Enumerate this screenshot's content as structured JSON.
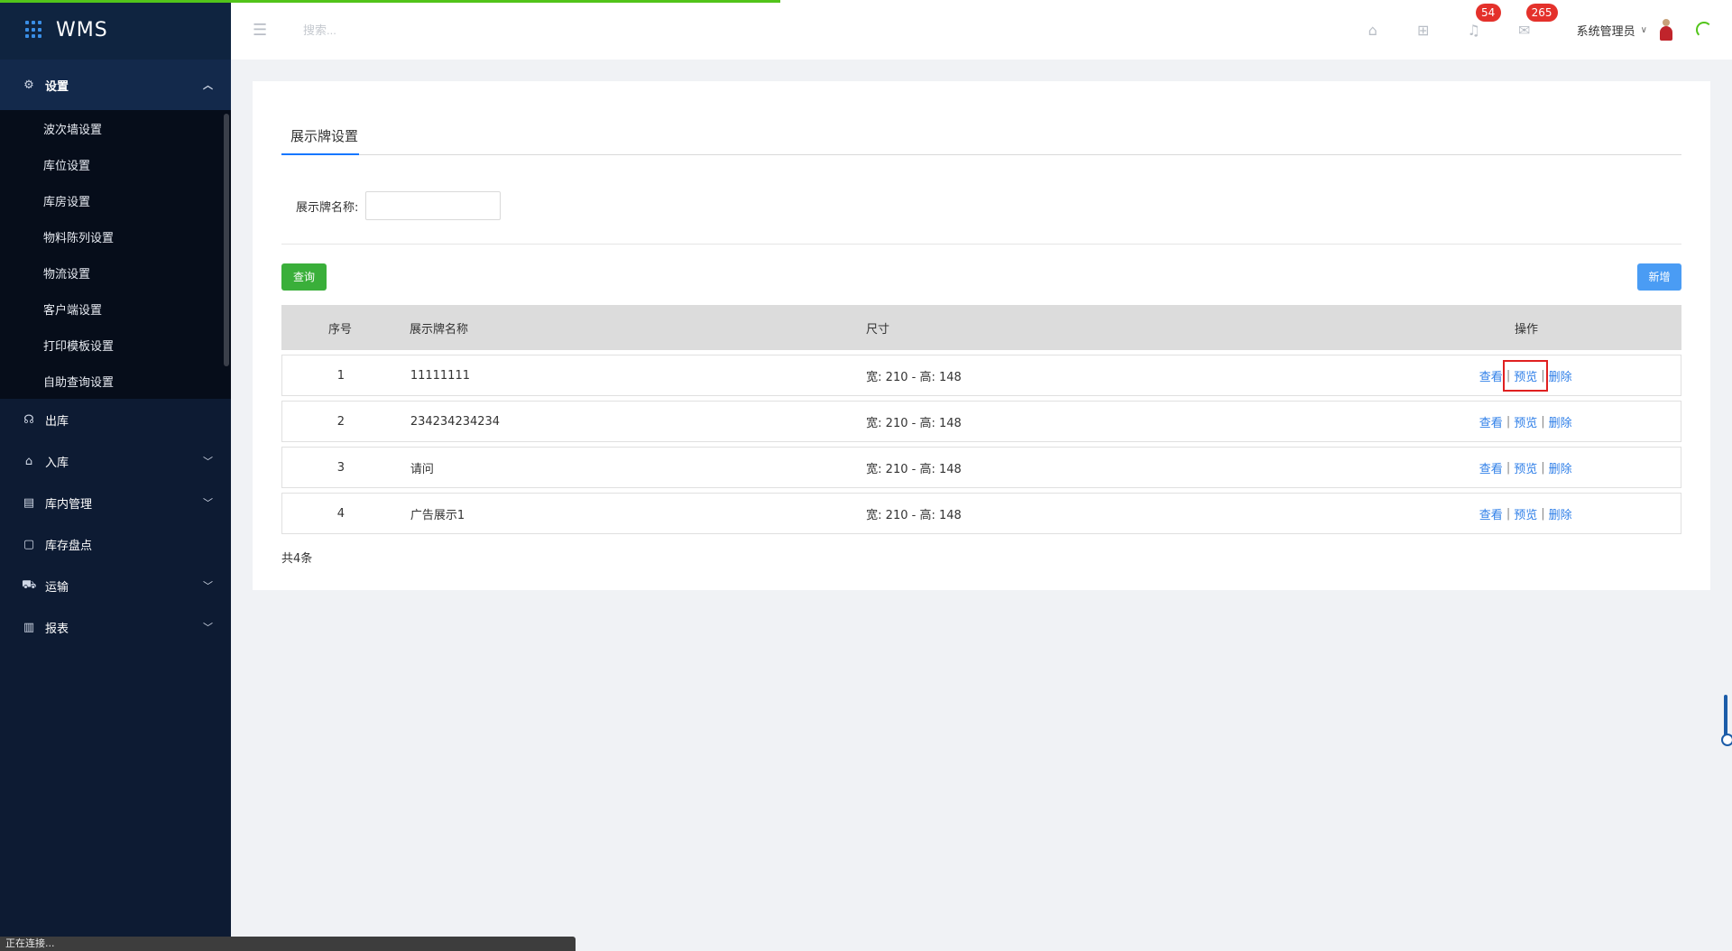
{
  "app": {
    "title": "WMS"
  },
  "header": {
    "search_placeholder": "搜索...",
    "notification_count": "54",
    "message_count": "265",
    "user_name": "系统管理员"
  },
  "sidebar": {
    "sections": [
      {
        "label": "设置",
        "icon": "gear-icon",
        "expanded": true,
        "items": [
          "波次墙设置",
          "库位设置",
          "库房设置",
          "物料陈列设置",
          "物流设置",
          "客户端设置",
          "打印模板设置",
          "自助查询设置"
        ]
      }
    ],
    "items": [
      {
        "label": "出库",
        "icon": "headset-icon",
        "has_children": false
      },
      {
        "label": "入库",
        "icon": "home-icon",
        "has_children": true
      },
      {
        "label": "库内管理",
        "icon": "box-icon",
        "has_children": true
      },
      {
        "label": "库存盘点",
        "icon": "document-icon",
        "has_children": false
      },
      {
        "label": "运输",
        "icon": "truck-icon",
        "has_children": true
      },
      {
        "label": "报表",
        "icon": "bar-chart-icon",
        "has_children": true
      }
    ]
  },
  "main": {
    "tab": "展示牌设置",
    "filter": {
      "label": "展示牌名称:",
      "value": ""
    },
    "query_button": "查询",
    "add_button": "新增",
    "table": {
      "columns": [
        "序号",
        "展示牌名称",
        "尺寸",
        "操作"
      ],
      "rows": [
        {
          "idx": "1",
          "name": "11111111",
          "size": "宽: 210 - 高: 148"
        },
        {
          "idx": "2",
          "name": "234234234234",
          "size": "宽: 210 - 高: 148"
        },
        {
          "idx": "3",
          "name": "请问",
          "size": "宽: 210 - 高: 148"
        },
        {
          "idx": "4",
          "name": "广告展示1",
          "size": "宽: 210 - 高: 148"
        }
      ],
      "actions": {
        "view": "查看",
        "preview": "预览",
        "delete": "删除",
        "separator": "|"
      }
    },
    "total": "共4条"
  },
  "statusbar": {
    "text": "正在连接..."
  },
  "colors": {
    "sidebar_bg": "#0d1b33",
    "accent": "#1677ff",
    "query_button": "#3aaf3a",
    "add_button": "#4a9cf4",
    "badge": "#e4312b",
    "highlight": "#e02020"
  }
}
